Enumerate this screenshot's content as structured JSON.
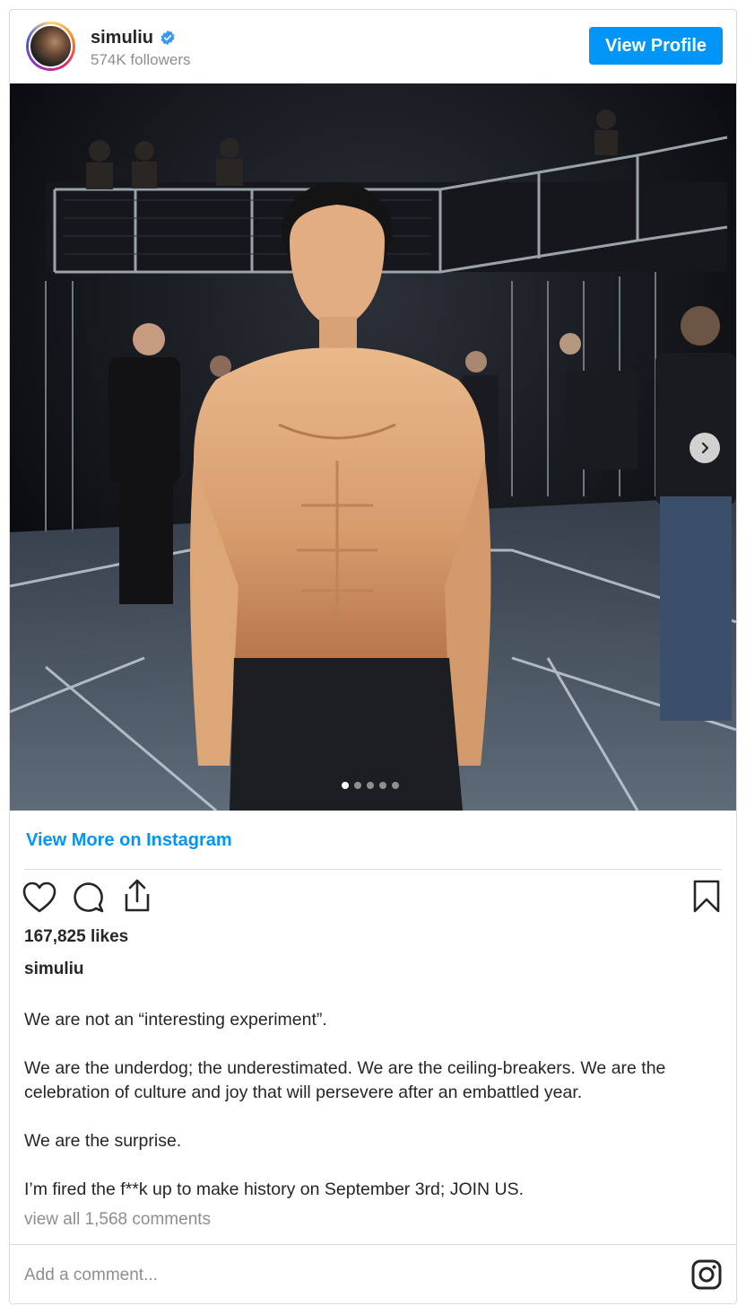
{
  "header": {
    "username": "simuliu",
    "followers": "574K followers",
    "view_profile_label": "View Profile"
  },
  "post": {
    "carousel": {
      "slide_count": 5,
      "active_index": 0
    },
    "view_more_label": "View More on Instagram",
    "likes": "167,825 likes",
    "caption_username": "simuliu",
    "caption_paragraphs": [
      "We are not an “interesting experiment”.",
      "We are the underdog; the underestimated. We are the ceiling-breakers. We are the celebration of culture and joy that will persevere after an embattled year.",
      "We are the surprise.",
      "I’m fired the f**k up to make history on September 3rd; JOIN US."
    ],
    "comments_link": "view all 1,568 comments",
    "add_comment_placeholder": "Add a comment..."
  },
  "icons": {
    "verified": "verified-badge-icon",
    "like": "heart-icon",
    "comment": "comment-bubble-icon",
    "share": "share-icon",
    "save": "bookmark-icon",
    "next": "chevron-right-icon",
    "brand": "instagram-icon"
  },
  "colors": {
    "accent": "#0095f6",
    "muted_text": "#8e8e8e",
    "border": "#dbdbdb"
  }
}
